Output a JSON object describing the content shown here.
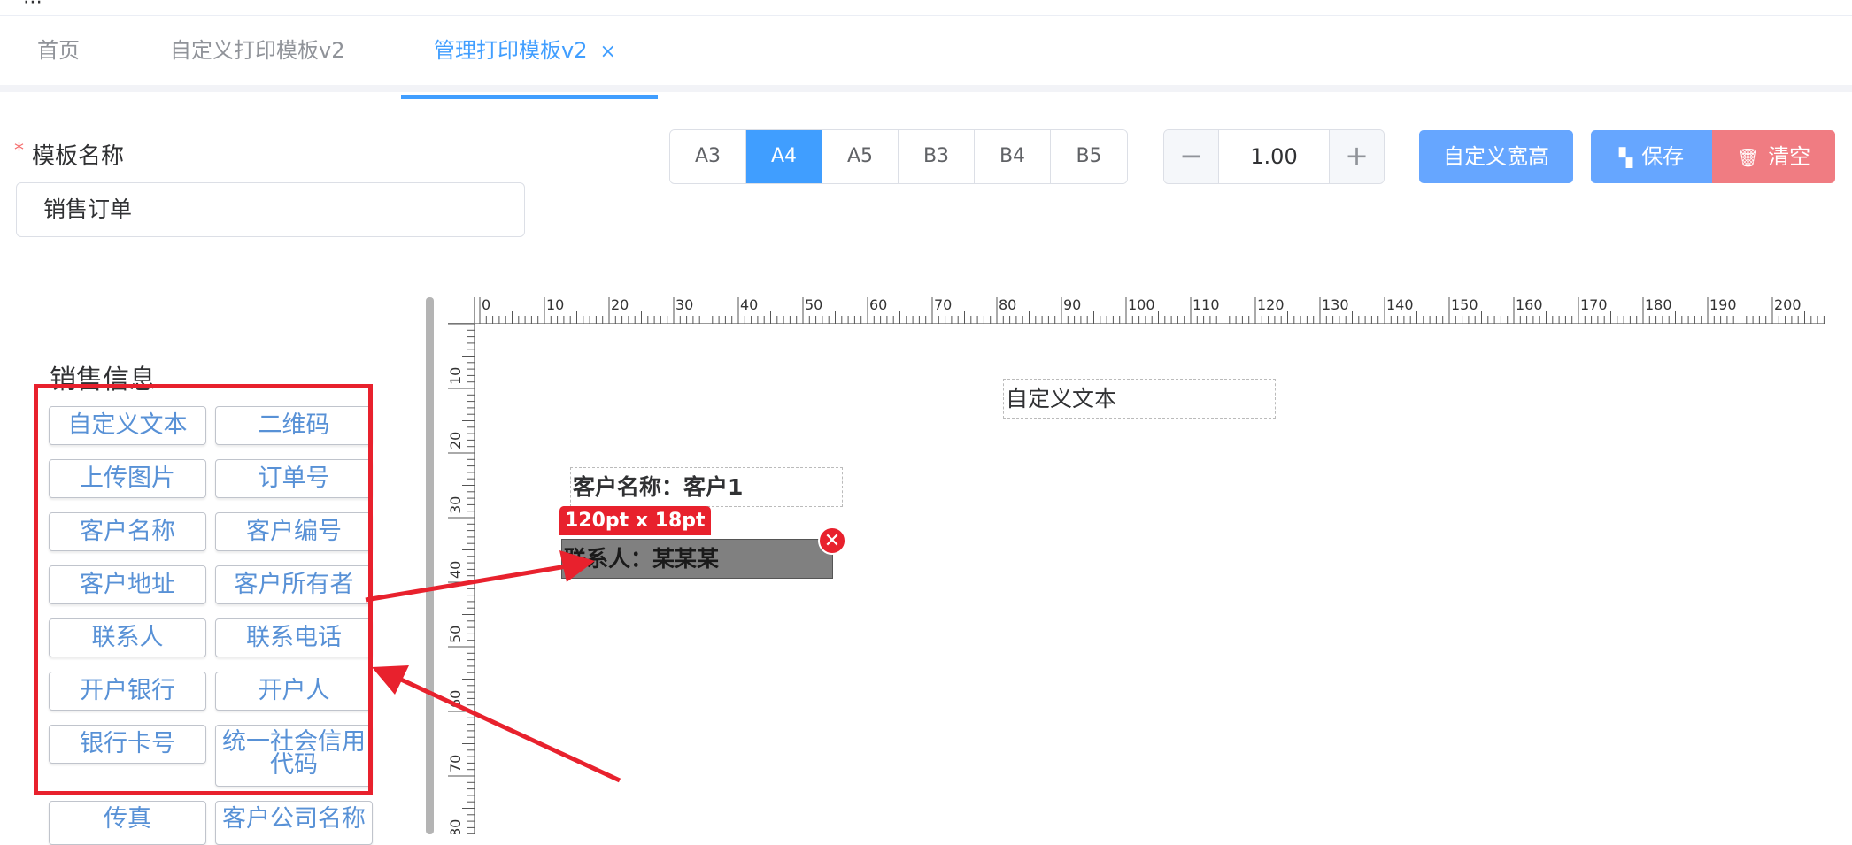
{
  "tabs": [
    {
      "label": "首页",
      "active": false
    },
    {
      "label": "自定义打印模板v2",
      "active": false
    },
    {
      "label": "管理打印模板v2",
      "active": true
    }
  ],
  "tab_close_glyph": "×",
  "form": {
    "required_mark": "*",
    "name_label": "模板名称",
    "name_value": "销售订单"
  },
  "paper_sizes": [
    {
      "label": "A3",
      "active": false
    },
    {
      "label": "A4",
      "active": true
    },
    {
      "label": "A5",
      "active": false
    },
    {
      "label": "B3",
      "active": false
    },
    {
      "label": "B4",
      "active": false
    },
    {
      "label": "B5",
      "active": false
    }
  ],
  "zoom": {
    "value": "1.00",
    "minus": "−",
    "plus": "+"
  },
  "toolbar": {
    "custom_size_label": "自定义宽高",
    "save_label": "保存",
    "clear_label": "清空"
  },
  "panel": {
    "title": "销售信息",
    "components": [
      "自定义文本",
      "二维码",
      "上传图片",
      "订单号",
      "客户名称",
      "客户编号",
      "客户地址",
      "客户所有者",
      "联系人",
      "联系电话",
      "开户银行",
      "开户人",
      "银行卡号",
      "统一社会信用代码",
      "传真",
      "客户公司名称"
    ]
  },
  "ruler": {
    "top_labels": [
      "0",
      "10",
      "20",
      "30",
      "40",
      "50",
      "60",
      "70",
      "80",
      "90",
      "100",
      "110",
      "120",
      "130",
      "140",
      "150",
      "160",
      "170",
      "180",
      "190",
      "200"
    ],
    "left_labels": [
      "10",
      "20",
      "30",
      "40",
      "50",
      "60",
      "70",
      "80"
    ]
  },
  "canvas": {
    "custom_text": "自定义文本",
    "customer_name": "客户名称：客户1",
    "contact": "联系人：某某某",
    "size_badge": "120pt x 18pt",
    "remove_glyph": "✕"
  },
  "colors": {
    "primary": "#409eff",
    "danger": "#f07c82",
    "annotation": "#e8212d"
  }
}
